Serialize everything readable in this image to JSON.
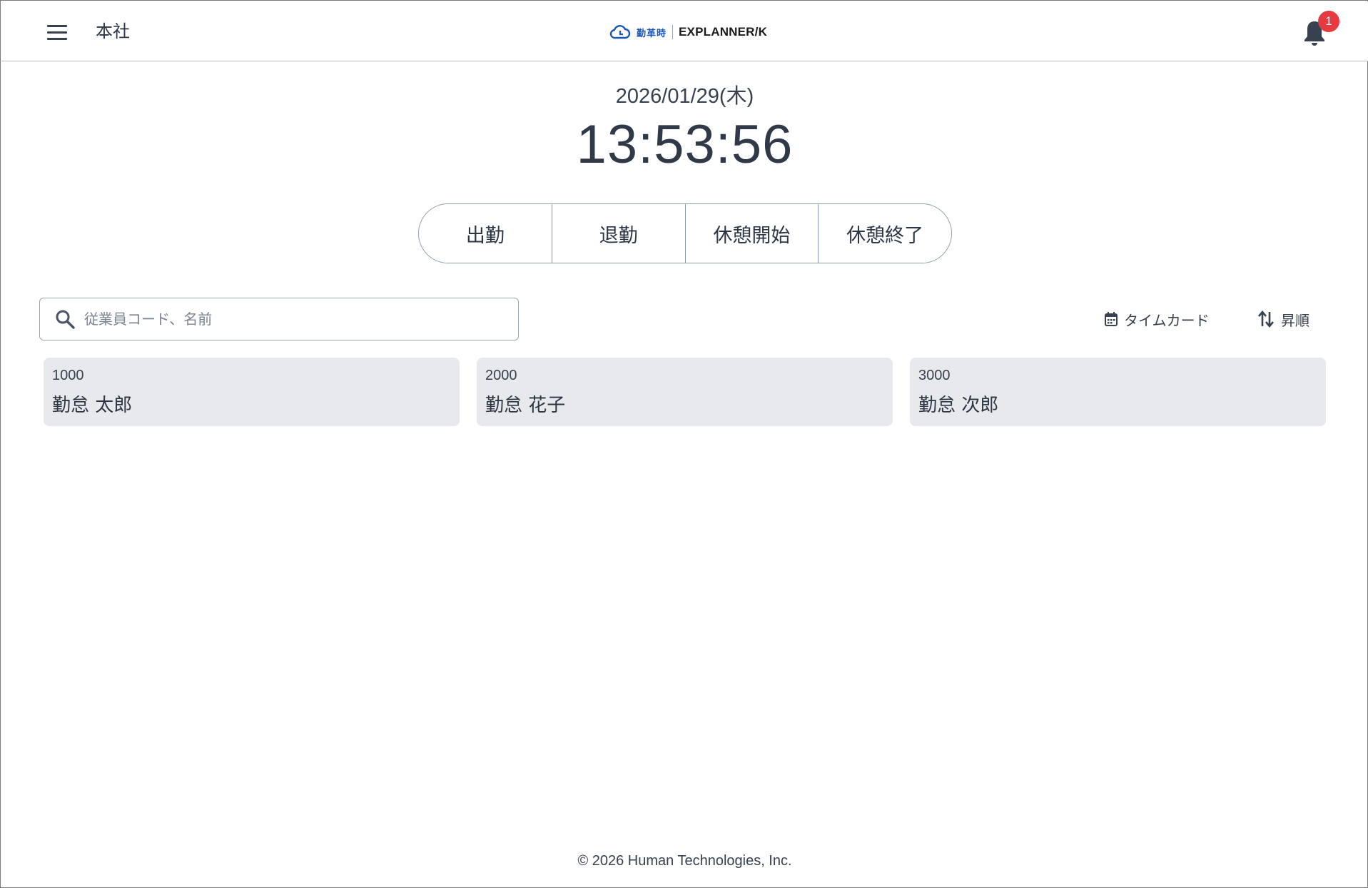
{
  "header": {
    "office": "本社",
    "logo_jp": "勤革時",
    "logo_en": "EXPLANNER/K",
    "notification_count": "1"
  },
  "clock": {
    "date": "2026/01/29(木)",
    "time": "13:53:56"
  },
  "punch": {
    "clock_in": "出勤",
    "clock_out": "退勤",
    "break_start": "休憩開始",
    "break_end": "休憩終了"
  },
  "search": {
    "placeholder": "従業員コード、名前"
  },
  "toolbar": {
    "timecard": "タイムカード",
    "sort": "昇順"
  },
  "employees": [
    {
      "code": "1000",
      "name": "勤怠 太郎"
    },
    {
      "code": "2000",
      "name": "勤怠 花子"
    },
    {
      "code": "3000",
      "name": "勤怠 次郎"
    }
  ],
  "footer": "© 2026 Human Technologies, Inc.",
  "colors": {
    "text": "#2d3645",
    "badge": "#e53a3f",
    "card": "#e8e9ec",
    "logo_blue": "#1c57b8"
  }
}
